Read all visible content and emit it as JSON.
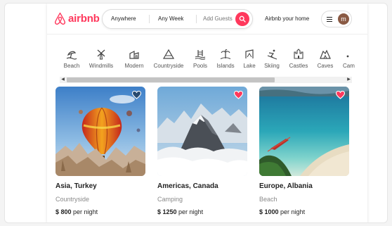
{
  "brand": {
    "name": "airbnb",
    "color": "#ff385c"
  },
  "search": {
    "location": "Anywhere",
    "dates": "Any Week",
    "guests": "Add Guests"
  },
  "header": {
    "host_label": "Airbnb your home",
    "avatar_initial": "m"
  },
  "categories": [
    {
      "label": "Beach",
      "icon": "beach-icon"
    },
    {
      "label": "Windmills",
      "icon": "windmill-icon"
    },
    {
      "label": "Modern",
      "icon": "modern-house-icon"
    },
    {
      "label": "Countryside",
      "icon": "countryside-icon"
    },
    {
      "label": "Pools",
      "icon": "pool-icon"
    },
    {
      "label": "Islands",
      "icon": "island-icon"
    },
    {
      "label": "Lake",
      "icon": "lake-icon"
    },
    {
      "label": "Skiing",
      "icon": "skiing-icon"
    },
    {
      "label": "Castles",
      "icon": "castle-icon"
    },
    {
      "label": "Caves",
      "icon": "cave-icon"
    },
    {
      "label": "Cam",
      "icon": "camping-icon"
    }
  ],
  "listings": [
    {
      "title": "Asia, Turkey",
      "type": "Countryside",
      "price": "$ 800",
      "per": "per night",
      "favorite": false
    },
    {
      "title": "Americas, Canada",
      "type": "Camping",
      "price": "$ 1250",
      "per": "per night",
      "favorite": true
    },
    {
      "title": "Europe, Albania",
      "type": "Beach",
      "price": "$ 1000",
      "per": "per night",
      "favorite": true
    }
  ]
}
